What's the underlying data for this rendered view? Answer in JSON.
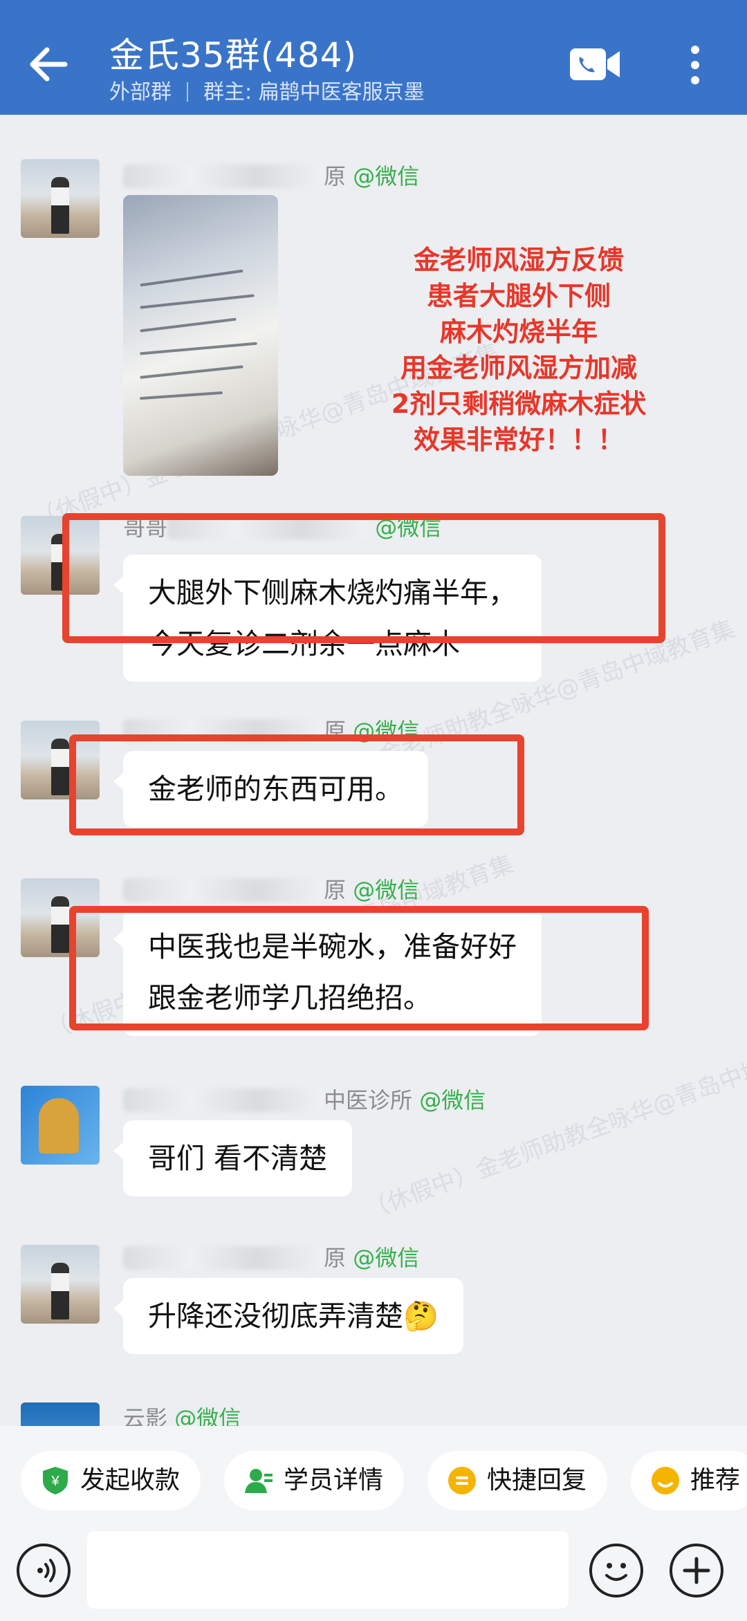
{
  "header": {
    "title": "金氏35群(484)",
    "group_type": "外部群",
    "owner_label": "群主: 扁鹊中医客服京墨"
  },
  "overlay_note": {
    "lines": [
      "金老师风湿方反馈",
      "患者大腿外下侧",
      "麻木灼烧半年",
      "用金老师风湿方加减",
      "2剂只剩稍微麻木症状",
      "效果非常好！！！"
    ],
    "color": "#e8362a"
  },
  "messages": [
    {
      "sender_visible": "原",
      "tag": "@微信",
      "type": "image"
    },
    {
      "sender_visible": "哥哥",
      "tag": "@微信",
      "type": "text",
      "lines": [
        "大腿外下侧麻木烧灼痛半年，",
        "今天复诊二剂余一点麻木"
      ]
    },
    {
      "sender_visible": "原",
      "tag": "@微信",
      "type": "text",
      "lines": [
        "金老师的东西可用。"
      ]
    },
    {
      "sender_visible": "原",
      "tag": "@微信",
      "type": "text",
      "lines": [
        "中医我也是半碗水，准备好好",
        "跟金老师学几招绝招。"
      ]
    },
    {
      "sender_visible": "中医诊所",
      "tag": "@微信",
      "type": "text",
      "lines": [
        "哥们  看不清楚"
      ]
    },
    {
      "sender_visible": "原",
      "tag": "@微信",
      "type": "text",
      "lines": [
        "升降还没彻底弄清楚🤔"
      ]
    },
    {
      "sender_visible": "云影",
      "tag": "@微信",
      "type": "text",
      "lines": []
    }
  ],
  "watermark_text": "（休假中）金老师助教全咏华@青岛中域教育集",
  "quick_actions": [
    {
      "label": "发起收款",
      "icon": "payment-shield-icon",
      "color": "#2dab4b"
    },
    {
      "label": "学员详情",
      "icon": "student-profile-icon",
      "color": "#2dab4b"
    },
    {
      "label": "快捷回复",
      "icon": "quick-reply-icon",
      "color": "#f5b400"
    },
    {
      "label": "推荐",
      "icon": "recommend-icon",
      "color": "#f5b400"
    }
  ],
  "colors": {
    "header_bg": "#3a74c9",
    "wechat_tag": "#36b04b",
    "highlight_box": "#e8432e",
    "chat_bg": "#eceef1"
  }
}
